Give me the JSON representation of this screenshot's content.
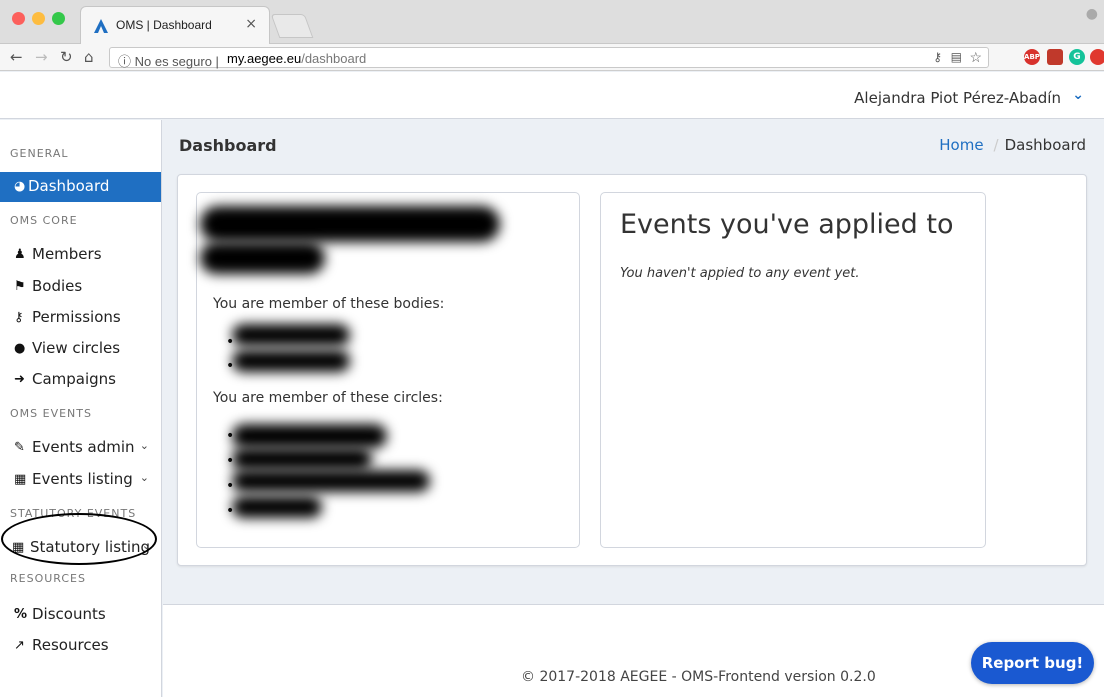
{
  "browser": {
    "tab_title": "OMS | Dashboard",
    "tab_close": "×",
    "url_info": "ⓘ No es seguro  |",
    "url_host": "my.aegee.eu",
    "url_path": "/dashboard",
    "ext_labels": [
      "ABP",
      "",
      "G",
      ""
    ]
  },
  "header": {
    "user_name": "Alejandra Piot Pérez-Abadín",
    "user_menu_icon": "chevron-down-icon"
  },
  "sidebar": {
    "sections": {
      "general": "GENERAL",
      "oms_core": "OMS CORE",
      "oms_events": "OMS EVENTS",
      "statutory_events": "STATUTORY EVENTS",
      "resources": "RESOURCES"
    },
    "items": [
      {
        "label": "Dashboard",
        "icon": "tachometer-icon"
      },
      {
        "label": "Members",
        "icon": "user-icon"
      },
      {
        "label": "Bodies",
        "icon": "flag-icon"
      },
      {
        "label": "Permissions",
        "icon": "key-icon"
      },
      {
        "label": "View circles",
        "icon": "circle-icon"
      },
      {
        "label": "Campaigns",
        "icon": "sign-in-icon"
      },
      {
        "label": "Events admin",
        "icon": "wrench-icon"
      },
      {
        "label": "Events listing",
        "icon": "calendar-icon"
      },
      {
        "label": "Statutory listing",
        "icon": "calendar-icon"
      },
      {
        "label": "Discounts",
        "icon": "percent-icon"
      },
      {
        "label": "Resources",
        "icon": "external-link-icon"
      }
    ]
  },
  "main": {
    "title": "Dashboard",
    "breadcrumb": {
      "home": "Home",
      "current": "Dashboard"
    },
    "profile_card": {
      "bodies_label": "You are member of these bodies:",
      "circles_label": "You are member of these circles:"
    },
    "events_card": {
      "title": "Events you've applied to",
      "empty_text": "You haven't appied to any event yet."
    }
  },
  "footer": {
    "text": "© 2017-2018 AEGEE - OMS-Frontend version 0.2.0",
    "report_button": "Report bug!"
  },
  "colors": {
    "accent": "#1f6fc2",
    "report_button": "#1a59d1",
    "page_bg": "#ecf0f5"
  }
}
